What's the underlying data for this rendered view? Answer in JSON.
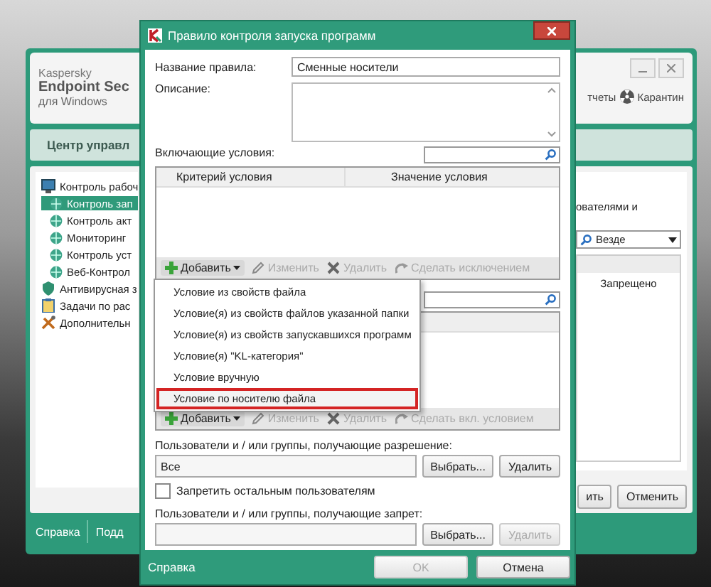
{
  "background_window": {
    "logo": {
      "brand": "Kaspersky",
      "product": "Endpoint Sec",
      "platform": "для Windows"
    },
    "header_links": [
      {
        "label": "тчеты",
        "kind": "reports"
      },
      {
        "label": "Карантин",
        "kind": "quarantine"
      }
    ],
    "section_title": "Центр управл",
    "tree": [
      {
        "label": "Контроль рабоч",
        "kind": "monitor",
        "selected": false,
        "children": [
          {
            "label": "Контроль зап",
            "selected": true
          },
          {
            "label": "Контроль акт",
            "selected": false
          },
          {
            "label": "Мониторинг",
            "selected": false
          },
          {
            "label": "Контроль уст",
            "selected": false
          },
          {
            "label": "Веб-Контрол",
            "selected": false
          }
        ]
      },
      {
        "label": "Антивирусная з",
        "kind": "shield",
        "selected": false
      },
      {
        "label": "Задачи по рас",
        "kind": "clipboard",
        "selected": false
      },
      {
        "label": "Дополнительн",
        "kind": "tools",
        "selected": false
      }
    ],
    "description_fragment": "ователями и",
    "scope_dropdown": "Везде",
    "table_cell": "Запрещено",
    "buttons": [
      "ить",
      "Отменить"
    ],
    "footer_links": [
      "Справка",
      "Подд"
    ]
  },
  "dialog": {
    "title": "Правило контроля запуска программ",
    "name_label": "Название правила:",
    "name_value": "Сменные носители",
    "description_label": "Описание:",
    "include_label": "Включающие условия:",
    "include_columns": [
      "Критерий условия",
      "Значение условия"
    ],
    "include_toolbar": [
      {
        "label": "Добавить",
        "kind": "add",
        "disabled": false
      },
      {
        "label": "Изменить",
        "kind": "edit",
        "disabled": true
      },
      {
        "label": "Удалить",
        "kind": "delete",
        "disabled": true
      },
      {
        "label": "Сделать исключением",
        "kind": "convert",
        "disabled": true
      }
    ],
    "exclude_toolbar": [
      {
        "label": "Добавить",
        "kind": "add",
        "disabled": false
      },
      {
        "label": "Изменить",
        "kind": "edit",
        "disabled": true
      },
      {
        "label": "Удалить",
        "kind": "delete",
        "disabled": true
      },
      {
        "label": "Сделать вкл. условием",
        "kind": "convert",
        "disabled": true
      }
    ],
    "allow_label": "Пользователи и / или группы, получающие разрешение:",
    "allow_value": "Все",
    "allow_buttons": [
      {
        "label": "Выбрать...",
        "disabled": false
      },
      {
        "label": "Удалить",
        "disabled": false
      }
    ],
    "deny_checkbox": {
      "label": "Запретить остальным пользователям",
      "checked": false
    },
    "deny_label": "Пользователи и / или группы, получающие запрет:",
    "deny_buttons": [
      {
        "label": "Выбрать...",
        "disabled": false
      },
      {
        "label": "Удалить",
        "disabled": true
      }
    ],
    "footer_link": "Справка",
    "footer_buttons": [
      {
        "label": "OK",
        "disabled": true
      },
      {
        "label": "Отмена",
        "disabled": false
      }
    ]
  },
  "add_menu": {
    "items": [
      {
        "label": "Условие из свойств файла",
        "selected": false
      },
      {
        "label": "Условие(я) из свойств файлов указанной папки",
        "selected": false
      },
      {
        "label": "Условие(я) из свойств запускавшихся программ",
        "selected": false
      },
      {
        "label": "Условие(я) \"KL-категория\"",
        "selected": false
      },
      {
        "label": "Условие вручную",
        "selected": false
      },
      {
        "label": "Условие по носителю файла",
        "selected": true
      }
    ]
  }
}
